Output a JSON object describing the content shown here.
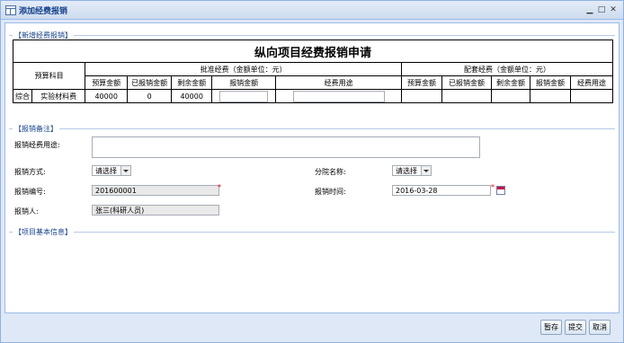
{
  "window": {
    "title": "添加经费报销",
    "min": "▁",
    "max": "□",
    "close": "✕"
  },
  "sections": {
    "new_reimb": "【新增经费报销】",
    "remark": "【报销备注】",
    "project_info": "【项目基本信息】"
  },
  "table": {
    "title": "纵向项目经费报销申请",
    "budget_subject": "预算科目",
    "approved_header": "批准经费（金额单位：元）",
    "matching_header": "配套经费（金额单位：元）",
    "approved_cols": [
      "预算金额",
      "已报销金额",
      "剩余金额",
      "报销金额",
      "经费用途"
    ],
    "matching_cols": [
      "预算金额",
      "已报销金额",
      "剩余金额",
      "报销金额",
      "经费用途"
    ],
    "row": {
      "category": "综合",
      "item": "实验材料费",
      "budget": "40000",
      "reimbursed": "0",
      "remaining": "40000"
    }
  },
  "form": {
    "purpose_label": "报销经费用途:",
    "method_label": "报销方式:",
    "method_value": "请选择",
    "branch_label": "分院名称:",
    "branch_value": "请选择",
    "number_label": "报销编号:",
    "number_value": "201600001",
    "time_label": "报销时间:",
    "time_value": "2016-03-28",
    "person_label": "报销人:",
    "person_value": "张三(科研人员)",
    "required_mark": "*"
  },
  "buttons": {
    "save_draft": "暂存",
    "submit": "提交",
    "cancel": "取消"
  }
}
